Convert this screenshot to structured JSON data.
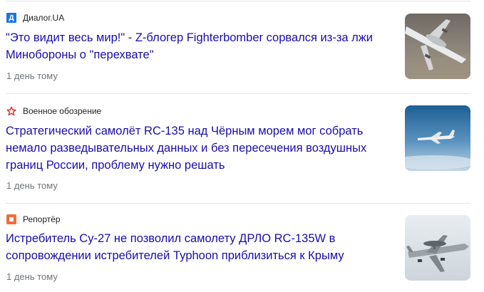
{
  "articles": [
    {
      "source": "Диалог.UA",
      "source_icon": "dialog-ua-icon",
      "source_color": "#1a73e8",
      "source_letter": "Д",
      "headline_lines": [
        "\"Это видит весь мир!\" - Z-блогер Fighterbomber сорвался из-за лжи",
        "Минобороны о \"перехвате\""
      ],
      "time": "1 день тому"
    },
    {
      "source": "Военное обозрение",
      "source_icon": "red-star-icon",
      "source_color": "#d32f2f",
      "headline_lines": [
        "Стратегический самолёт RC-135 над Чёрным морем мог собрать",
        "немало разведывательных данных и без пересечения воздушных",
        "границ России, проблему нужно решать"
      ],
      "time": "1 день тому"
    },
    {
      "source": "Репортёр",
      "source_icon": "reporter-icon",
      "source_color": "#f26b3a",
      "headline_lines": [
        "Истребитель Су-27 не позволил самолету ДРЛО RC-135W в",
        "сопровождении истребителей Typhoon приблизиться к Крыму"
      ],
      "time": "1 день тому"
    }
  ],
  "link_color": "#1a0dab"
}
